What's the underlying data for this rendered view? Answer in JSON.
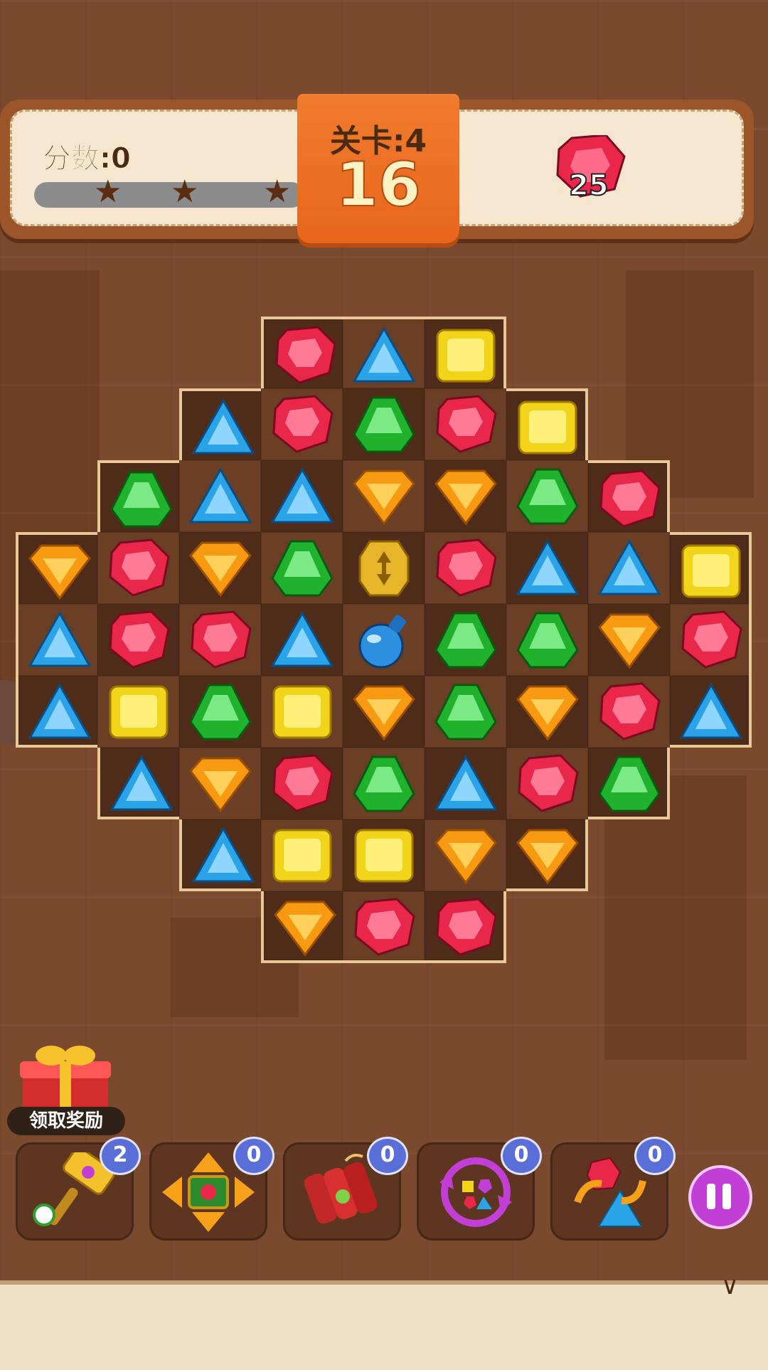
{
  "header": {
    "score_label": "分数:0",
    "level_label": "关卡:4",
    "moves_remaining": "16",
    "goal_count": "25",
    "goal_gem": "red",
    "stars": 3,
    "progress": 0
  },
  "board": {
    "rows": [
      [
        "",
        "",
        "",
        "red",
        "blue",
        "yellow",
        "",
        "",
        ""
      ],
      [
        "",
        "",
        "blue",
        "red",
        "green",
        "red",
        "yellow",
        "",
        ""
      ],
      [
        "",
        "green",
        "blue",
        "blue",
        "orange",
        "orange",
        "green",
        "red",
        ""
      ],
      [
        "orange",
        "red",
        "orange",
        "green",
        "striped",
        "red",
        "blue",
        "blue",
        "yellow"
      ],
      [
        "blue",
        "red",
        "red",
        "blue",
        "potion",
        "green",
        "green",
        "orange",
        "red"
      ],
      [
        "blue",
        "yellow",
        "green",
        "yellow",
        "orange",
        "green",
        "orange",
        "red",
        "blue"
      ],
      [
        "",
        "blue",
        "orange",
        "red",
        "green",
        "blue",
        "red",
        "green",
        ""
      ],
      [
        "",
        "",
        "blue",
        "yellow",
        "yellow",
        "orange",
        "orange",
        "",
        ""
      ],
      [
        "",
        "",
        "",
        "orange",
        "red",
        "red",
        "",
        "",
        ""
      ]
    ]
  },
  "reward": {
    "label": "领取奖励"
  },
  "boosters": [
    {
      "name": "hammer",
      "count": "2"
    },
    {
      "name": "arrows-cross",
      "count": "0"
    },
    {
      "name": "dynamite",
      "count": "0"
    },
    {
      "name": "shuffle",
      "count": "0"
    },
    {
      "name": "swap-gems",
      "count": "0"
    }
  ],
  "colors": {
    "red": "#e8274b",
    "blue": "#2aa3e8",
    "green": "#20b22d",
    "yellow": "#f2d41a",
    "orange": "#f79a12",
    "accent": "#e8661c",
    "pause": "#c23fd6"
  }
}
